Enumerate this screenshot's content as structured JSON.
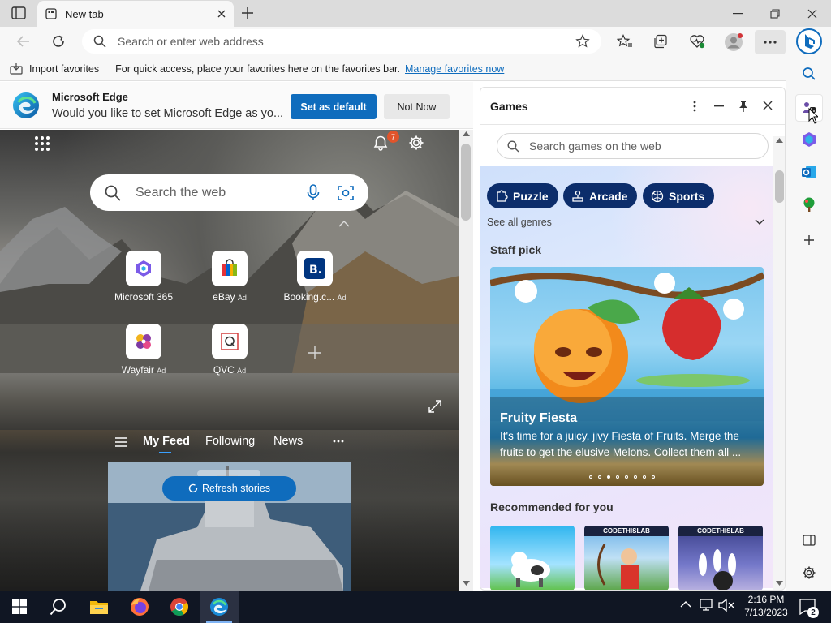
{
  "browser": {
    "tab_title": "New tab",
    "search_placeholder": "Search or enter web address"
  },
  "favorites_bar": {
    "import_label": "Import favorites",
    "hint": "For quick access, place your favorites here on the favorites bar.",
    "manage_link": "Manage favorites now"
  },
  "banner": {
    "title": "Microsoft Edge",
    "message": "Would you like to set Microsoft Edge as yo...",
    "set_default": "Set as default",
    "not_now": "Not Now"
  },
  "newtab": {
    "notification_count": "7",
    "search_placeholder": "Search the web",
    "tiles": [
      {
        "label": "Microsoft 365",
        "ad": ""
      },
      {
        "label": "eBay",
        "ad": "Ad"
      },
      {
        "label": "Booking.c...",
        "ad": "Ad"
      },
      {
        "label": "Wayfair",
        "ad": "Ad"
      },
      {
        "label": "QVC",
        "ad": "Ad"
      }
    ],
    "feed_tabs": [
      "My Feed",
      "Following",
      "News"
    ],
    "refresh_label": "Refresh stories"
  },
  "games": {
    "title": "Games",
    "search_placeholder": "Search games on the web",
    "genres": [
      "Puzzle",
      "Arcade",
      "Sports"
    ],
    "see_all": "See all genres",
    "staff_pick_label": "Staff pick",
    "hero": {
      "title": "Fruity Fiesta",
      "description": "It's time for a juicy, jivy Fiesta of Fruits. Merge the fruits to get the elusive Melons. Collect them all ..."
    },
    "recommended_label": "Recommended for you",
    "rec_badge": "CODETHISLAB"
  },
  "taskbar": {
    "time": "2:16 PM",
    "date": "7/13/2023",
    "notification_count": "2"
  },
  "colors": {
    "accent": "#0f6cbd",
    "chip": "#0c2d6b",
    "taskbar": "#101623"
  }
}
